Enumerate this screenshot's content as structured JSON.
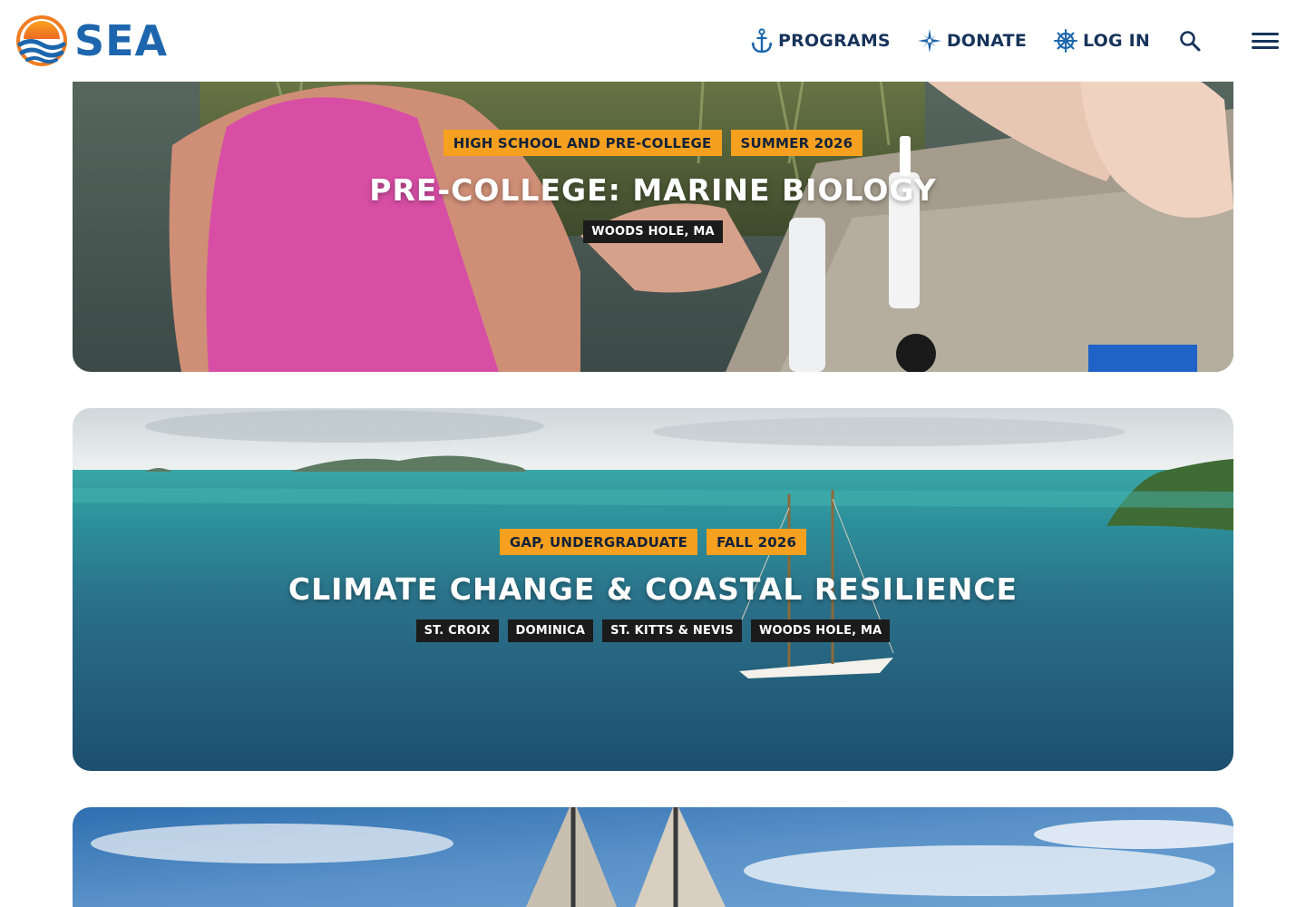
{
  "brand": {
    "name": "SEA",
    "colors": {
      "primary": "#1d66ad",
      "navy": "#17335a",
      "orange": "#f6a01f",
      "sun": "#f07d22"
    }
  },
  "nav": {
    "items": [
      {
        "label": "PROGRAMS",
        "icon": "anchor-icon"
      },
      {
        "label": "DONATE",
        "icon": "compass-star-icon"
      },
      {
        "label": "LOG IN",
        "icon": "ship-wheel-icon"
      }
    ],
    "search_icon": "search-icon",
    "menu_icon": "hamburger-menu-icon"
  },
  "cards": [
    {
      "tags": [
        "HIGH SCHOOL AND PRE-COLLEGE",
        "SUMMER 2026"
      ],
      "title": "PRE-COLLEGE: MARINE BIOLOGY",
      "locations": [
        "WOODS HOLE, MA"
      ]
    },
    {
      "tags": [
        "GAP, UNDERGRADUATE",
        "FALL 2026"
      ],
      "title": "CLIMATE CHANGE & COASTAL RESILIENCE",
      "locations": [
        "ST. CROIX",
        "DOMINICA",
        "ST. KITTS & NEVIS",
        "WOODS HOLE, MA"
      ]
    },
    {
      "tags": [],
      "title": "",
      "locations": []
    }
  ]
}
